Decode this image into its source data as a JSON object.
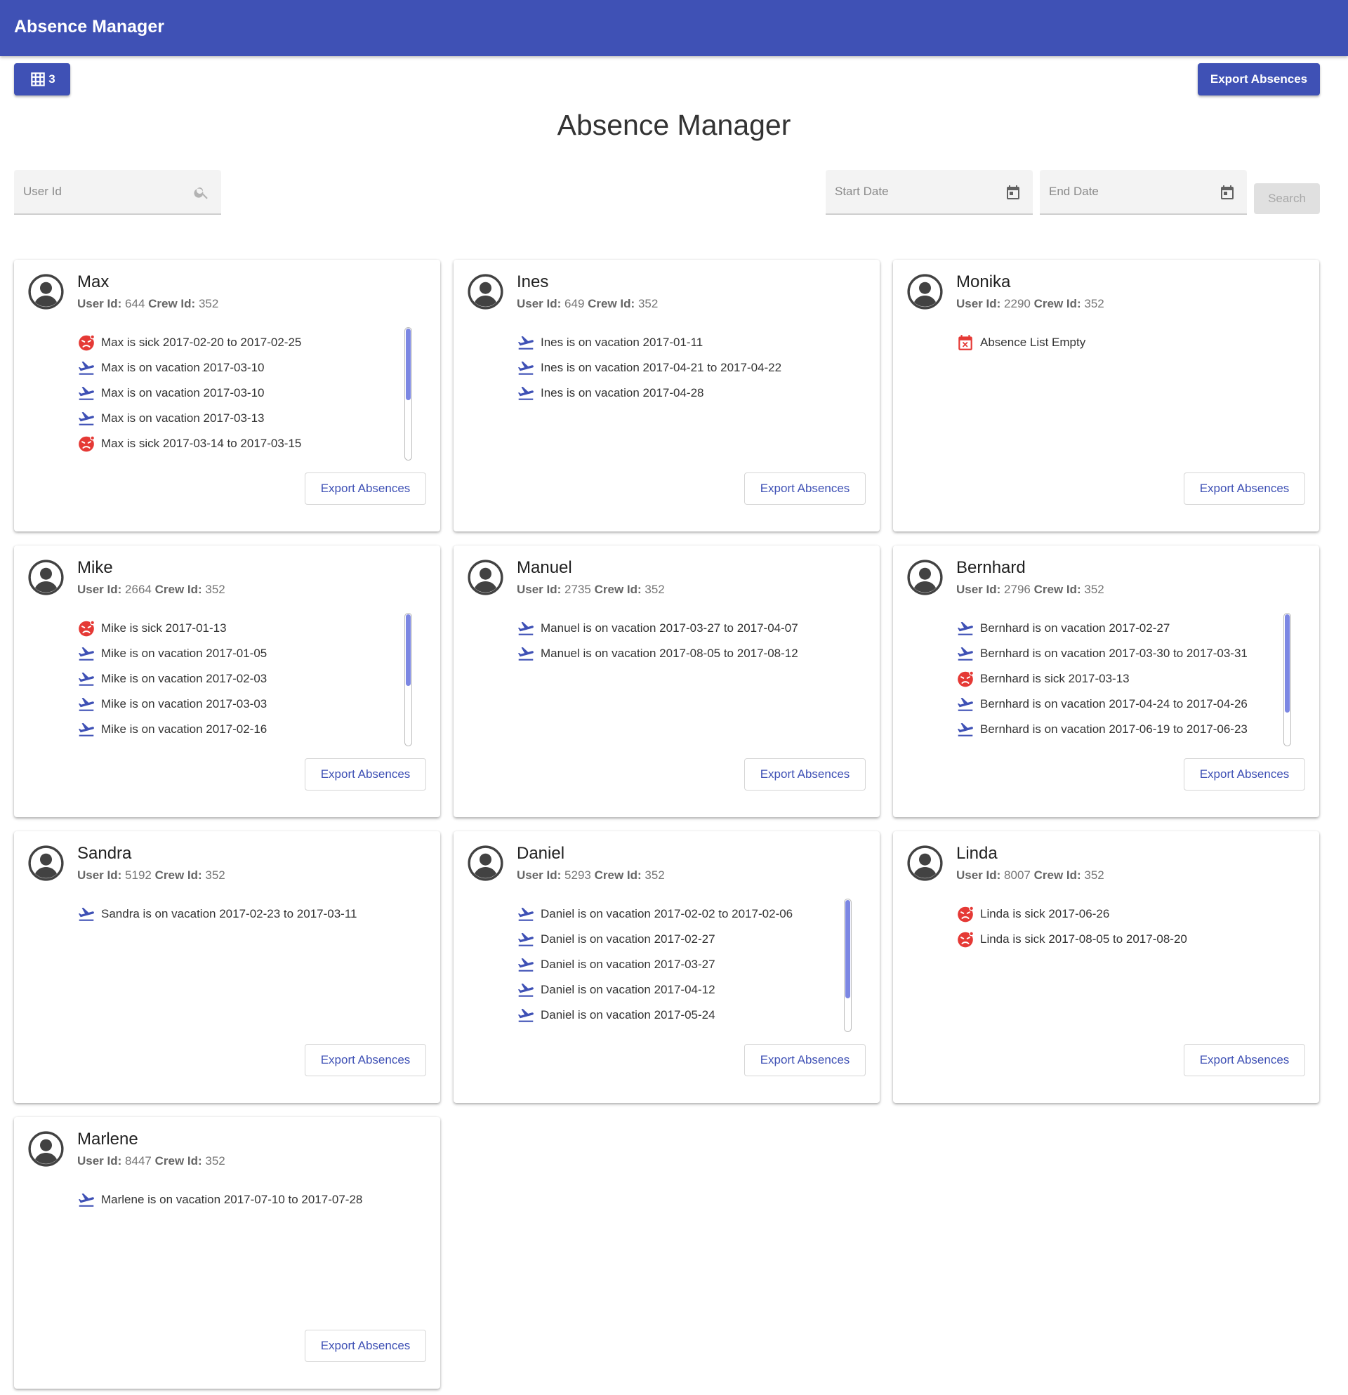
{
  "app": {
    "title": "Absence Manager"
  },
  "toolbar": {
    "grid_count": "3",
    "export_label": "Export Absences"
  },
  "page": {
    "title": "Absence Manager"
  },
  "filters": {
    "user_id_placeholder": "User Id",
    "start_placeholder": "Start Date",
    "end_placeholder": "End Date",
    "search_label": "Search"
  },
  "labels": {
    "user_id": "User Id:",
    "crew_id": "Crew Id:",
    "export": "Export Absences",
    "empty": "Absence List Empty"
  },
  "colors": {
    "primary": "#3f51b5",
    "sick": "#e53935",
    "empty": "#e53935",
    "scroll_thumb": "#7c87e3"
  },
  "icons": {
    "vacation": "flight-takeoff-icon",
    "sick": "sick-face-icon",
    "empty": "calendar-remove-icon"
  },
  "members": [
    {
      "name": "Max",
      "user_id": "644",
      "crew_id": "352",
      "scroll": {
        "visible_fraction": 0.55,
        "position": 0
      },
      "absences": [
        {
          "type": "sick",
          "text": "Max is sick 2017-02-20 to 2017-02-25"
        },
        {
          "type": "vacation",
          "text": "Max is on vacation 2017-03-10"
        },
        {
          "type": "vacation",
          "text": "Max is on vacation 2017-03-10"
        },
        {
          "type": "vacation",
          "text": "Max is on vacation 2017-03-13"
        },
        {
          "type": "sick",
          "text": "Max is sick 2017-03-14 to 2017-03-15"
        }
      ]
    },
    {
      "name": "Ines",
      "user_id": "649",
      "crew_id": "352",
      "scroll": null,
      "absences": [
        {
          "type": "vacation",
          "text": "Ines is on vacation 2017-01-11"
        },
        {
          "type": "vacation",
          "text": "Ines is on vacation 2017-04-21 to 2017-04-22"
        },
        {
          "type": "vacation",
          "text": "Ines is on vacation 2017-04-28"
        }
      ]
    },
    {
      "name": "Monika",
      "user_id": "2290",
      "crew_id": "352",
      "scroll": null,
      "absences": []
    },
    {
      "name": "Mike",
      "user_id": "2664",
      "crew_id": "352",
      "scroll": {
        "visible_fraction": 0.55,
        "position": 0
      },
      "absences": [
        {
          "type": "sick",
          "text": "Mike is sick 2017-01-13"
        },
        {
          "type": "vacation",
          "text": "Mike is on vacation 2017-01-05"
        },
        {
          "type": "vacation",
          "text": "Mike is on vacation 2017-02-03"
        },
        {
          "type": "vacation",
          "text": "Mike is on vacation 2017-03-03"
        },
        {
          "type": "vacation",
          "text": "Mike is on vacation 2017-02-16"
        }
      ]
    },
    {
      "name": "Manuel",
      "user_id": "2735",
      "crew_id": "352",
      "scroll": null,
      "absences": [
        {
          "type": "vacation",
          "text": "Manuel is on vacation 2017-03-27 to 2017-04-07"
        },
        {
          "type": "vacation",
          "text": "Manuel is on vacation 2017-08-05 to 2017-08-12"
        }
      ]
    },
    {
      "name": "Bernhard",
      "user_id": "2796",
      "crew_id": "352",
      "scroll": {
        "visible_fraction": 0.75,
        "position": 0
      },
      "absences": [
        {
          "type": "vacation",
          "text": "Bernhard is on vacation 2017-02-27"
        },
        {
          "type": "vacation",
          "text": "Bernhard is on vacation 2017-03-30 to 2017-03-31"
        },
        {
          "type": "sick",
          "text": "Bernhard is sick 2017-03-13"
        },
        {
          "type": "vacation",
          "text": "Bernhard is on vacation 2017-04-24 to 2017-04-26"
        },
        {
          "type": "vacation",
          "text": "Bernhard is on vacation 2017-06-19 to 2017-06-23"
        }
      ]
    },
    {
      "name": "Sandra",
      "user_id": "5192",
      "crew_id": "352",
      "scroll": null,
      "absences": [
        {
          "type": "vacation",
          "text": "Sandra is on vacation 2017-02-23 to 2017-03-11"
        }
      ]
    },
    {
      "name": "Daniel",
      "user_id": "5293",
      "crew_id": "352",
      "scroll": {
        "visible_fraction": 0.75,
        "position": 0
      },
      "absences": [
        {
          "type": "vacation",
          "text": "Daniel is on vacation 2017-02-02 to 2017-02-06"
        },
        {
          "type": "vacation",
          "text": "Daniel is on vacation 2017-02-27"
        },
        {
          "type": "vacation",
          "text": "Daniel is on vacation 2017-03-27"
        },
        {
          "type": "vacation",
          "text": "Daniel is on vacation 2017-04-12"
        },
        {
          "type": "vacation",
          "text": "Daniel is on vacation 2017-05-24"
        }
      ]
    },
    {
      "name": "Linda",
      "user_id": "8007",
      "crew_id": "352",
      "scroll": null,
      "absences": [
        {
          "type": "sick",
          "text": "Linda is sick 2017-06-26"
        },
        {
          "type": "sick",
          "text": "Linda is sick 2017-08-05 to 2017-08-20"
        }
      ]
    },
    {
      "name": "Marlene",
      "user_id": "8447",
      "crew_id": "352",
      "scroll": null,
      "absences": [
        {
          "type": "vacation",
          "text": "Marlene is on vacation 2017-07-10 to 2017-07-28"
        }
      ]
    }
  ]
}
